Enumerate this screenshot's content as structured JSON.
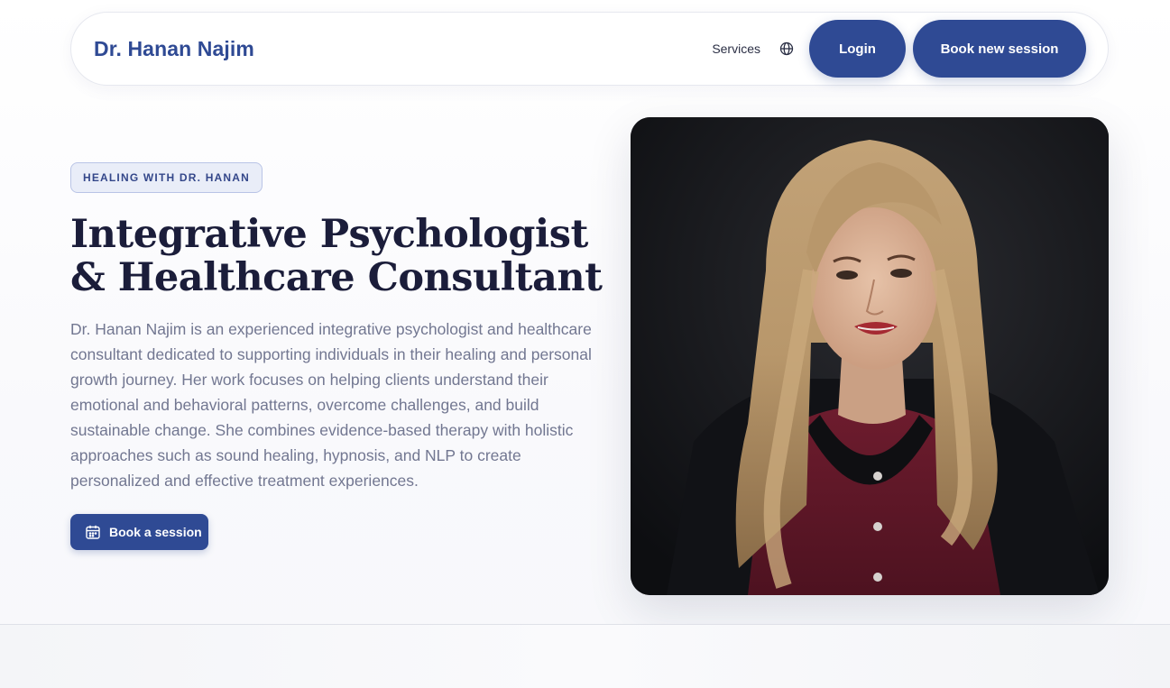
{
  "nav": {
    "brand": "Dr. Hanan Najim",
    "services_label": "Services",
    "language_icon": "globe-icon",
    "login_label": "Login",
    "book_new_label": "Book new session"
  },
  "hero": {
    "badge": "HEALING WITH DR. HANAN",
    "headline_line1": "Integrative Psychologist",
    "headline_line2": "& Healthcare Consultant",
    "intro": "Dr. Hanan Najim is an experienced integrative psychologist and healthcare consultant dedicated to supporting individuals in their healing and personal growth journey. Her work focuses on helping clients understand their emotional and behavioral patterns, overcome challenges, and build sustainable change. She combines evidence-based therapy with holistic approaches such as sound healing, hypnosis, and NLP to create personalized and effective treatment experiences.",
    "cta_label": "Book a session",
    "cta_icon": "calendar-icon"
  },
  "colors": {
    "primary": "#2f4a94",
    "heading": "#1b1d3a",
    "body_text": "#727791",
    "badge_bg": "#e9edf8"
  }
}
